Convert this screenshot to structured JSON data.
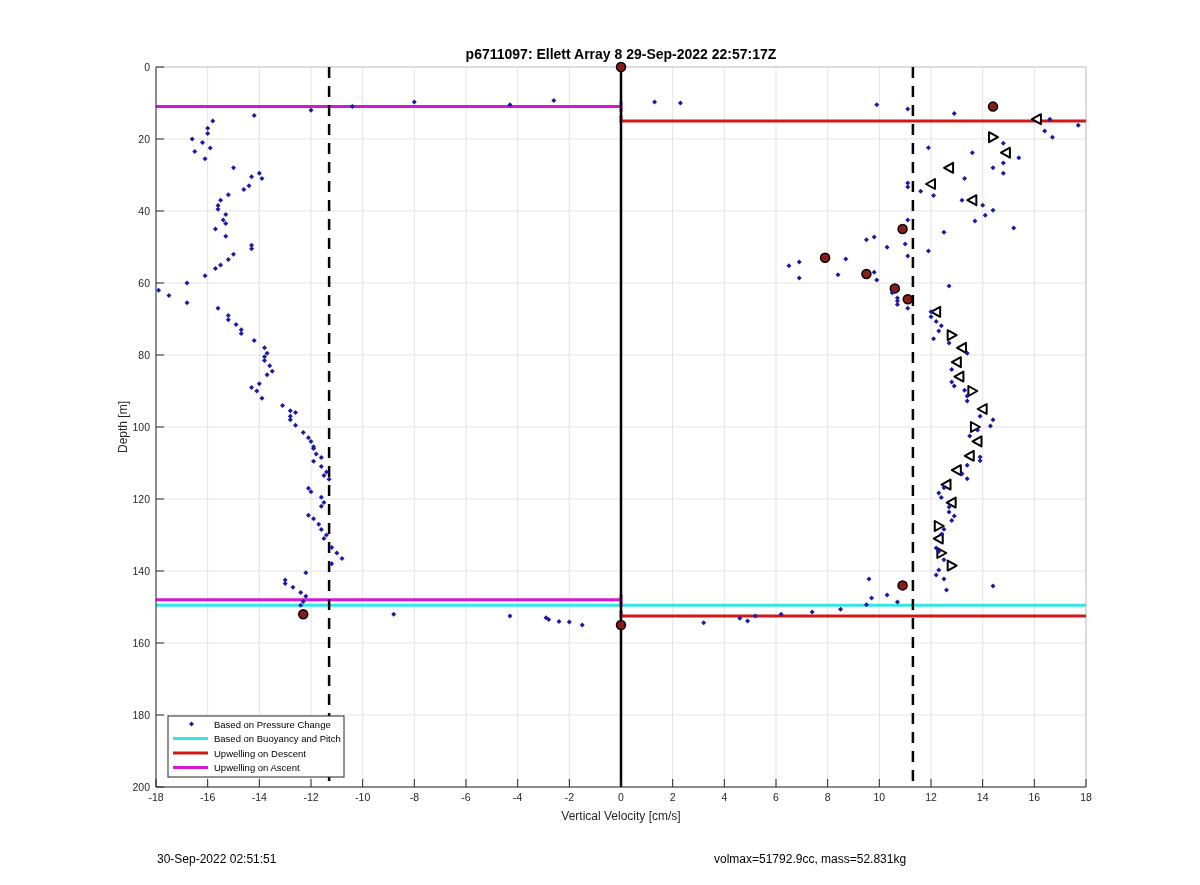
{
  "figure": {
    "chart_data": {
      "type": "scatter",
      "title": "p6711097: Ellett Array 8 29-Sep-2022 22:57:17Z",
      "xlabel": "Vertical Velocity [cm/s]",
      "ylabel": "Depth [m]",
      "grid": true,
      "legend": true,
      "xlim": [
        -18,
        18
      ],
      "ylim": [
        200,
        0
      ],
      "xticks": [
        {
          "value": -18,
          "label": "-18"
        },
        {
          "value": -16,
          "label": "-16"
        },
        {
          "value": -14,
          "label": "-14"
        },
        {
          "value": -12,
          "label": "-12"
        },
        {
          "value": -10,
          "label": "-10"
        },
        {
          "value": -8,
          "label": "-8"
        },
        {
          "value": -6,
          "label": "-6"
        },
        {
          "value": -4,
          "label": "-4"
        },
        {
          "value": -2,
          "label": "-2"
        },
        {
          "value": 0,
          "label": "0"
        },
        {
          "value": 2,
          "label": "2"
        },
        {
          "value": 4,
          "label": "4"
        },
        {
          "value": 6,
          "label": "6"
        },
        {
          "value": 8,
          "label": "8"
        },
        {
          "value": 10,
          "label": "10"
        },
        {
          "value": 12,
          "label": "12"
        },
        {
          "value": 14,
          "label": "14"
        },
        {
          "value": 16,
          "label": "16"
        },
        {
          "value": 18,
          "label": "18"
        }
      ],
      "yticks": [
        {
          "value": 0,
          "label": "0"
        },
        {
          "value": 20,
          "label": "20"
        },
        {
          "value": 40,
          "label": "40"
        },
        {
          "value": 60,
          "label": "60"
        },
        {
          "value": 80,
          "label": "80"
        },
        {
          "value": 100,
          "label": "100"
        },
        {
          "value": 120,
          "label": "120"
        },
        {
          "value": 140,
          "label": "140"
        },
        {
          "value": 160,
          "label": "160"
        },
        {
          "value": 180,
          "label": "180"
        },
        {
          "value": 200,
          "label": "200"
        }
      ],
      "series": [
        {
          "type": "scatter",
          "marker": "diamond",
          "name": "Based on Pressure Change",
          "color": "#1a1aa6",
          "x": [
            -12,
            -10.4,
            -8,
            -4.3,
            -2.6,
            1.3,
            2.3,
            -14.2,
            -15.8,
            -16,
            -16,
            -16.6,
            -16.2,
            -15.9,
            -16.5,
            -16.1,
            -15,
            -14,
            -14.3,
            -13.9,
            -14.4,
            -14.6,
            -15.2,
            -15.5,
            -15.6,
            -15.6,
            -15.3,
            -15.4,
            -15.3,
            -15.7,
            -15.3,
            -14.3,
            -14.3,
            -15,
            -15.2,
            -15.5,
            -15.7,
            -16.1,
            -16.8,
            -17.9,
            -17.5,
            -16.8,
            -15.6,
            -15.2,
            -15.2,
            -14.9,
            -14.7,
            -14.7,
            -14.2,
            -13.8,
            -13.7,
            -13.8,
            -13.8,
            -13.6,
            -13.5,
            -13.7,
            -14.3,
            -14,
            -14.1,
            -13.9,
            -13.1,
            -12.8,
            -12.6,
            -12.8,
            -12.8,
            -12.6,
            -12.3,
            -12.1,
            -12,
            -11.9,
            -11.9,
            -11.8,
            -11.6,
            -11.9,
            -11.6,
            -11.4,
            -11.5,
            -11.3,
            -12.1,
            -12,
            -11.6,
            -11.5,
            -11.6,
            -12.1,
            -11.9,
            -11.7,
            -11.6,
            -11.4,
            -11.5,
            -11.2,
            -11,
            -10.8,
            -11.2,
            -12.2,
            -13,
            -13,
            -12.7,
            -12.4,
            -12.2,
            -12.3,
            -12.4,
            -8.8,
            -4.3,
            -2.9,
            -2.8,
            -2.4,
            -2,
            -1.5,
            9.9,
            11.1,
            12.9,
            16.6,
            17.7,
            16.4,
            16.7,
            14.8,
            11.9,
            13.6,
            15.4,
            14.8,
            14.4,
            14.8,
            13.3,
            11.1,
            11.1,
            11.6,
            12.1,
            13.2,
            14,
            14.4,
            14.1,
            13.7,
            11.1,
            15.2,
            12.5,
            9.8,
            9.5,
            11,
            10.3,
            11.9,
            11.1,
            8.7,
            6.9,
            6.5,
            9.8,
            8.4,
            6.9,
            9.9,
            12.7,
            10.5,
            10.7,
            10.7,
            10.7,
            11.1,
            12,
            12,
            12.2,
            12.4,
            12.3,
            12.1,
            12.7,
            13.4,
            12.8,
            12.8,
            12.9,
            13.3,
            13.4,
            13.4,
            13.9,
            14.4,
            14.3,
            13.8,
            13.5,
            13.9,
            13.9,
            13.4,
            13.2,
            13.4,
            12.5,
            12.3,
            12.4,
            12.7,
            12.7,
            12.9,
            12.8,
            12.5,
            12.4,
            12.2,
            12.3,
            12.5,
            12.3,
            12.2,
            12.5,
            12.6,
            14.4,
            9.6,
            10.3,
            9.7,
            10.7,
            9.5,
            8.5,
            7.4,
            6.2,
            5.2,
            4.6,
            4.9,
            3.2
          ],
          "values": [
            12,
            11,
            9.7,
            10.5,
            9.3,
            9.7,
            10,
            13.5,
            15,
            17,
            18.5,
            20,
            21,
            22.5,
            23.5,
            25.5,
            28,
            29.5,
            30.5,
            31,
            33,
            34,
            35.5,
            37,
            38.5,
            39.5,
            41,
            42.5,
            43.5,
            45,
            47,
            49.5,
            50.5,
            52,
            53.5,
            55,
            56,
            58,
            60,
            62,
            63.5,
            65.5,
            67,
            69,
            70.2,
            71.5,
            73,
            74,
            76,
            78,
            79.5,
            80.5,
            81.5,
            83,
            84.5,
            85.5,
            89,
            88,
            90,
            92,
            94,
            95.5,
            96,
            97,
            98,
            99.5,
            101.5,
            103,
            104,
            105.5,
            106,
            107.5,
            108.5,
            109.5,
            111,
            112.5,
            113.5,
            114.5,
            117,
            118,
            119.5,
            121,
            122,
            124.5,
            125.5,
            127,
            128.5,
            130,
            131,
            133.5,
            135,
            136.5,
            138,
            140.5,
            142.5,
            143.5,
            144.5,
            146,
            147,
            148.5,
            149.5,
            152,
            152.5,
            153,
            153.5,
            154,
            154.2,
            155,
            10.5,
            11.7,
            12.9,
            14.5,
            16.2,
            17.8,
            19.5,
            21.2,
            22.4,
            23.8,
            25.2,
            26.7,
            28,
            29.5,
            31,
            32.2,
            33.3,
            34.5,
            35.7,
            37,
            38.4,
            39.8,
            41.2,
            42.8,
            42.5,
            44.7,
            45.9,
            47.2,
            48,
            49.2,
            50.1,
            51.1,
            52.5,
            53.3,
            54.2,
            55.2,
            57,
            57.7,
            58.6,
            59.2,
            60.8,
            62.7,
            64.2,
            65,
            66,
            67,
            68,
            69.4,
            70.7,
            71.9,
            73.3,
            75.5,
            76.7,
            79.5,
            84,
            87.5,
            88.6,
            89.8,
            91.4,
            92.8,
            97,
            98,
            99.7,
            100.8,
            102.5,
            108.3,
            109.4,
            110.6,
            113,
            114.4,
            116.9,
            118.3,
            119.6,
            122.2,
            123.6,
            124.7,
            126,
            128.4,
            129.8,
            133.6,
            134.6,
            136.9,
            139.7,
            141.1,
            142.2,
            145.3,
            144.2,
            142.2,
            146.7,
            147.5,
            148.6,
            149.4,
            150.6,
            151.4,
            152,
            152.5,
            153.1,
            153.9,
            154.4
          ]
        },
        {
          "type": "line",
          "name": "Based on Buoyancy and Pitch",
          "color": "#33e6e6",
          "x": [
            -18,
            18
          ],
          "values": [
            149.5,
            149.5
          ]
        },
        {
          "type": "line",
          "name": "Upwelling on Descent",
          "color": "#d01818",
          "x": [
            0,
            0,
            18,
            null,
            0,
            0,
            18
          ],
          "values": [
            13.5,
            15,
            15,
            null,
            151,
            152.5,
            152.5
          ]
        },
        {
          "type": "line",
          "name": "Upwelling on Ascent",
          "color": "#d616d6",
          "x": [
            -18,
            0,
            0,
            0,
            null,
            -18,
            0,
            0,
            0
          ],
          "values": [
            11,
            11,
            9.5,
            12.5,
            null,
            148,
            148,
            146.5,
            150
          ]
        },
        {
          "type": "line",
          "line_style": "dashed",
          "color": "#000000",
          "x": [
            -11.3,
            -11.3,
            null,
            11.3,
            11.3
          ],
          "values": [
            0,
            200,
            null,
            0,
            200
          ]
        },
        {
          "type": "line",
          "line_style": "solid",
          "color": "#000000",
          "x": [
            0,
            0
          ],
          "values": [
            0,
            200
          ]
        },
        {
          "type": "scatter",
          "marker": "triangle-left",
          "color": "#000000",
          "x": [
            16.1,
            14.9,
            12.7,
            12,
            13.6,
            12.2,
            13.2,
            13,
            13.1,
            14,
            13.8,
            13.5,
            13,
            12.6,
            12.8,
            12.3
          ],
          "values": [
            14.5,
            23.8,
            28,
            32.5,
            37,
            68,
            78,
            82,
            86,
            95,
            104,
            108,
            112,
            116,
            121,
            131
          ]
        },
        {
          "type": "scatter",
          "marker": "triangle-right",
          "color": "#000000",
          "x": [
            14.4,
            12.8,
            13.6,
            13.7,
            12.3,
            12.4,
            12.8
          ],
          "values": [
            19.5,
            74.5,
            90,
            100,
            127.5,
            135,
            138.5
          ]
        },
        {
          "type": "scatter",
          "marker": "circle",
          "color": "#8b1a1a",
          "x": [
            0,
            14.4,
            10.9,
            7.9,
            9.5,
            10.6,
            11.1,
            10.9,
            -12.3,
            0
          ],
          "values": [
            0,
            11,
            45,
            53,
            57.5,
            61.5,
            64.5,
            144,
            152,
            155
          ]
        }
      ]
    }
  },
  "footer": {
    "timestamp": "30-Sep-2022 02:51:51",
    "summary": "volmax=51792.9cc, mass=52.831kg"
  }
}
